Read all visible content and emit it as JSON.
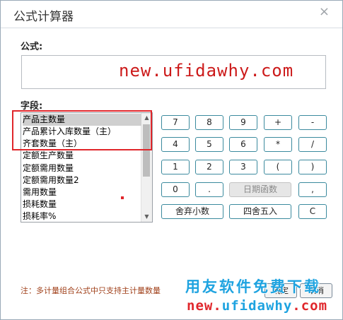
{
  "dialog": {
    "title": "公式计算器",
    "close_glyph": "×"
  },
  "formula": {
    "label": "公式:",
    "value": ""
  },
  "fields": {
    "label": "字段:",
    "items": [
      {
        "label": "产品主数量",
        "selected": true
      },
      {
        "label": "产品累计入库数量（主）",
        "selected": false
      },
      {
        "label": "齐套数量（主）",
        "selected": false
      },
      {
        "label": "定额生产数量",
        "selected": false
      },
      {
        "label": "定额需用数量",
        "selected": false
      },
      {
        "label": "定额需用数量2",
        "selected": false
      },
      {
        "label": "需用数量",
        "selected": false
      },
      {
        "label": "损耗数量",
        "selected": false
      },
      {
        "label": "损耗率%",
        "selected": false
      }
    ]
  },
  "keypad": {
    "keys": [
      {
        "label": "7",
        "enabled": true
      },
      {
        "label": "8",
        "enabled": true
      },
      {
        "label": "9",
        "enabled": true
      },
      {
        "label": "+",
        "enabled": true
      },
      {
        "label": "-",
        "enabled": true
      },
      {
        "label": "4",
        "enabled": true
      },
      {
        "label": "5",
        "enabled": true
      },
      {
        "label": "6",
        "enabled": true
      },
      {
        "label": "*",
        "enabled": true
      },
      {
        "label": "/",
        "enabled": true
      },
      {
        "label": "1",
        "enabled": true
      },
      {
        "label": "2",
        "enabled": true
      },
      {
        "label": "3",
        "enabled": true
      },
      {
        "label": "(",
        "enabled": true
      },
      {
        "label": ")",
        "enabled": true
      },
      {
        "label": "0",
        "enabled": true
      },
      {
        "label": ".",
        "enabled": true
      },
      {
        "label": "日期函数",
        "enabled": false
      },
      {
        "label": ",",
        "enabled": true
      },
      {
        "label": "舍弃小数",
        "enabled": true
      },
      {
        "label": "四舍五入",
        "enabled": true
      },
      {
        "label": "C",
        "enabled": true
      }
    ]
  },
  "footer": {
    "note": "注：多计量组合公式中只支持主计量数量",
    "confirm_label": "确定",
    "cancel_label": "取消"
  },
  "watermark": {
    "url_top": "new.ufidawhy.com",
    "brand": "用友软件免费下载",
    "url_bottom_p1": "new.",
    "url_bottom_p2": "ufidawhy",
    "url_bottom_p3": ".com"
  },
  "colors": {
    "key_border": "#3b8a9e",
    "annotation_red": "#e0262b",
    "footnote": "#a0401a",
    "watermark_blue": "#1ea3e0"
  }
}
